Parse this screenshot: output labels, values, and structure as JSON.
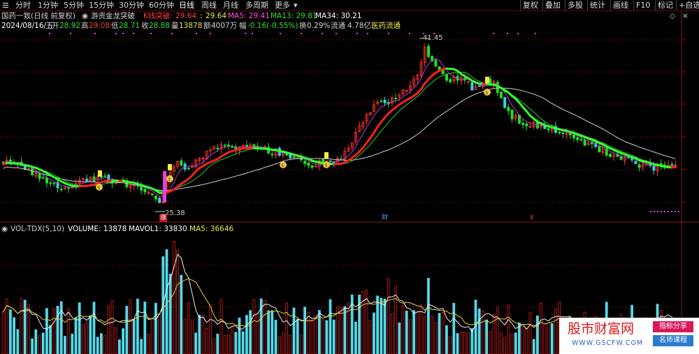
{
  "toolbar": {
    "menu_icon": "hamburger-icon",
    "tabs": [
      "分时",
      "1分钟",
      "5分钟",
      "15分钟",
      "30分钟",
      "60分钟",
      "日线",
      "周线",
      "月线",
      "多周期",
      "更多"
    ],
    "active_tab": "日线",
    "right_buttons": [
      "复权",
      "叠加",
      "多股",
      "统计",
      "画线",
      "F10",
      "标记",
      "+自选"
    ]
  },
  "header": {
    "stock_name": "国药一致(日线 前复权)",
    "indicator_name": "游资金龙突破",
    "indicators": {
      "k_break_label": "K线突破:",
      "k_break_val1": "29.64",
      "k_break_val2": "29.64",
      "ma5": "MA5: 29.41",
      "ma13": "MA13: 29.81",
      "ma34": "MA34: 30.21"
    }
  },
  "info_line": {
    "date": "2024/08/16/五",
    "open_label": "开",
    "open": "28.92",
    "high_label": "高",
    "high": "29.08",
    "low_label": "低",
    "low": "28.71",
    "close_label": "收",
    "close": "28.88",
    "vol_label": "量",
    "vol": "13878",
    "amount_label": "额",
    "amount": "4007万",
    "change_label": "幅",
    "change": "-0.16(-0.55%)",
    "turnover_label": "换",
    "turnover": "0.29%",
    "float_label": "流通",
    "float": "4.78亿",
    "sector": "医药流通"
  },
  "price_panel": {
    "high_marker": "41.45",
    "low_marker": "25.38",
    "events": [
      "涨",
      "财",
      "$"
    ]
  },
  "volume_panel": {
    "indicator_name": "VOL-TDX(5,10)",
    "volume": "VOLUME: 13878",
    "mavol1": "MAVOL1: 33830",
    "ma5": "MA5: 36646"
  },
  "watermark": {
    "brand": "股市财富网",
    "url": "WWW.GSCFW.COM",
    "tag1": "指标分享",
    "tag2": "名师课程"
  },
  "colors": {
    "up": "#ff3333",
    "down": "#33d4e0",
    "ma_green": "#33ff33",
    "ma_red": "#ff2020",
    "background": "#000000"
  }
}
